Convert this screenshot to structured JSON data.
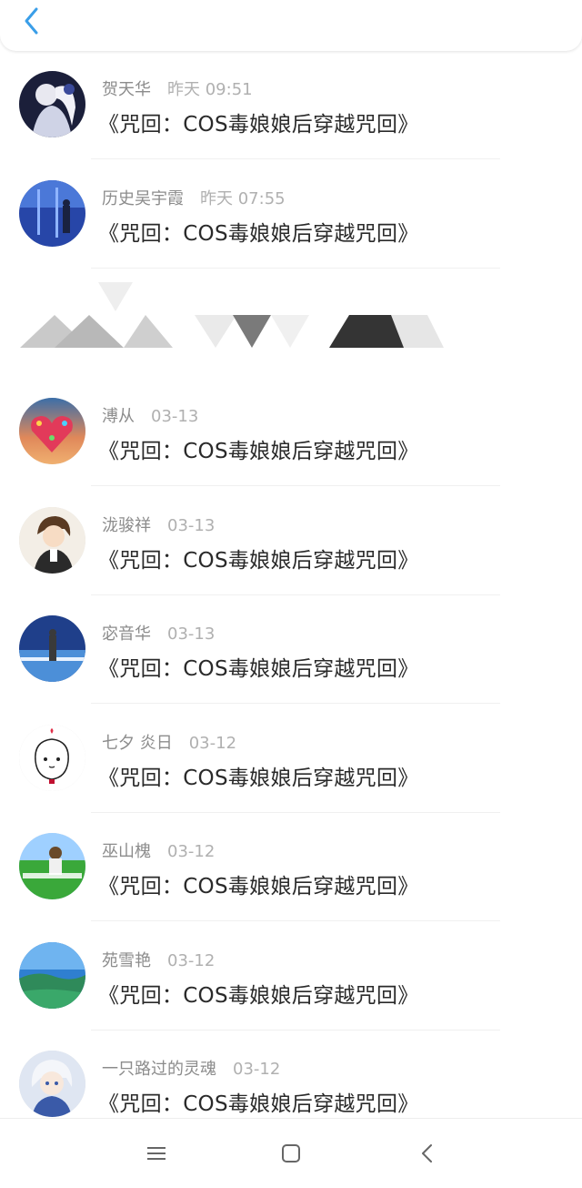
{
  "header": {
    "back_icon": "chevron-left-icon",
    "accent": "#3a9ee8"
  },
  "comments": [
    {
      "name": "贺天华",
      "time": "昨天 09:51",
      "text": "《咒回：COS毒娘娘后穿越咒回》",
      "avatar": "anime-girl-avatar"
    },
    {
      "name": "历史吴宇霞",
      "time": "昨天 07:55",
      "text": "《咒回：COS毒娘娘后穿越咒回》",
      "avatar": "night-scene-avatar"
    },
    {
      "name": "溥从",
      "time": "03-13",
      "text": "《咒回：COS毒娘娘后穿越咒回》",
      "avatar": "heart-balloons-avatar"
    },
    {
      "name": "泷骏祥",
      "time": "03-13",
      "text": "《咒回：COS毒娘娘后穿越咒回》",
      "avatar": "anime-boy-avatar"
    },
    {
      "name": "宓音华",
      "time": "03-13",
      "text": "《咒回：COS毒娘娘后穿越咒回》",
      "avatar": "sky-figure-avatar"
    },
    {
      "name": "七夕 炎日",
      "time": "03-12",
      "text": "《咒回：COS毒娘娘后穿越咒回》",
      "avatar": "cartoon-doodle-avatar"
    },
    {
      "name": "巫山槐",
      "time": "03-12",
      "text": "《咒回：COS毒娘娘后穿越咒回》",
      "avatar": "field-person-avatar"
    },
    {
      "name": "苑雪艳",
      "time": "03-12",
      "text": "《咒回：COS毒娘娘后穿越咒回》",
      "avatar": "landscape-avatar"
    },
    {
      "name": "一只路过的灵魂",
      "time": "03-12",
      "text": "《咒回：COS毒娘娘后穿越咒回》",
      "avatar": "white-hair-anime-avatar"
    }
  ],
  "navbar": {
    "menu_icon": "menu-icon",
    "home_icon": "home-square-icon",
    "back_icon": "back-chevron-icon"
  }
}
